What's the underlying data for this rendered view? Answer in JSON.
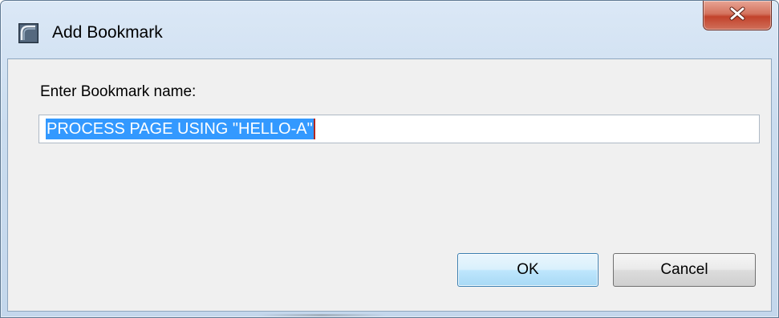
{
  "window": {
    "title": "Add Bookmark",
    "app_icon": "bookmark-app-icon",
    "close_icon": "close-x-icon"
  },
  "form": {
    "prompt_label": "Enter Bookmark name:",
    "name_value": "PROCESS PAGE USING \"HELLO-A\"",
    "name_selected": true
  },
  "buttons": {
    "ok_label": "OK",
    "cancel_label": "Cancel"
  },
  "colors": {
    "selection": "#3399ff",
    "close_button": "#c2422b",
    "default_button_border": "#3c7fb1"
  }
}
